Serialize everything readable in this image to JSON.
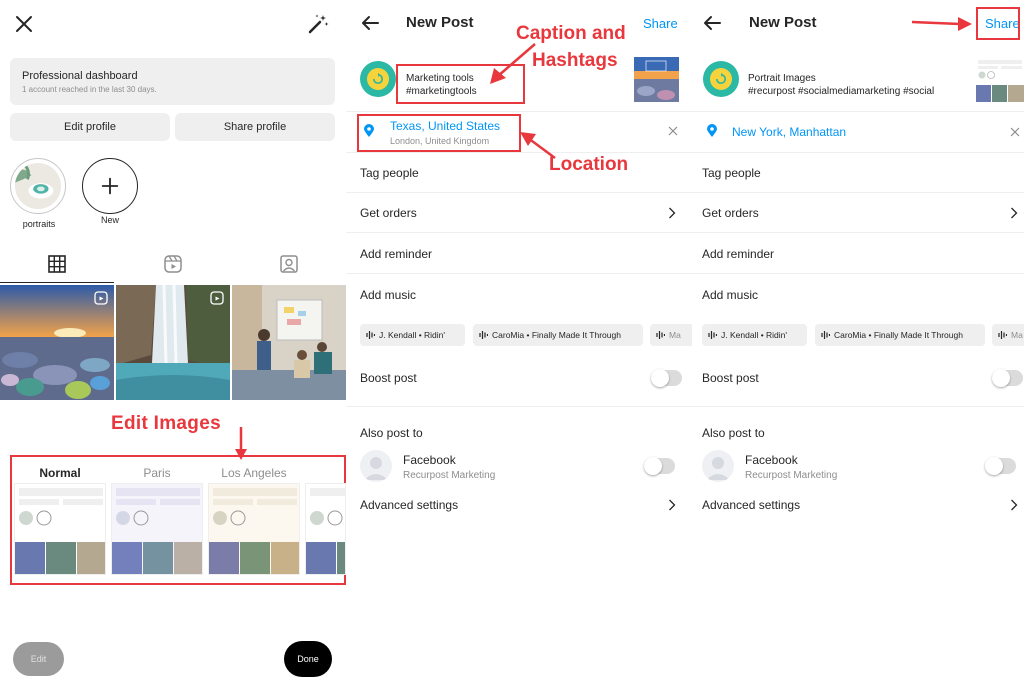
{
  "colors": {
    "annotation_red": "#e8383d",
    "link_blue": "#0095f6",
    "text": "#262626",
    "muted": "#8e8e8e",
    "chip_bg": "#efefef"
  },
  "panel1": {
    "icons": {
      "close": "close-icon",
      "magic": "magic-wand-icon"
    },
    "dashboard": {
      "title": "Professional dashboard",
      "subtitle": "1 account reached in the last 30 days."
    },
    "edit_profile": "Edit profile",
    "share_profile": "Share profile",
    "highlights": [
      {
        "label": "portraits"
      },
      {
        "label": "New"
      }
    ],
    "tabs": [
      "grid-icon",
      "reels-icon",
      "tagged-icon"
    ],
    "annotation": "Edit Images",
    "filters": [
      "Normal",
      "Paris",
      "Los Angeles"
    ],
    "edit_button": "Edit",
    "done_button": "Done"
  },
  "panel2": {
    "title": "New Post",
    "share": "Share",
    "caption_line1": "Marketing tools",
    "caption_line2": "#marketingtools",
    "location_main": "Texas, United States",
    "location_sub": "London, United Kingdom",
    "tag_people": "Tag people",
    "get_orders": "Get orders",
    "add_reminder": "Add reminder",
    "add_music": "Add music",
    "music_chips": [
      "J. Kendall • Ridin'",
      "CaroMia • Finally Made It Through",
      "Ma"
    ],
    "boost_post": "Boost post",
    "also_post_to": "Also post to",
    "facebook_name": "Facebook",
    "facebook_sub": "Recurpost Marketing",
    "advanced_settings": "Advanced settings",
    "annotations": {
      "caption_line1": "Caption and",
      "caption_line2": "Hashtags",
      "location": "Location"
    }
  },
  "panel3": {
    "title": "New Post",
    "share": "Share",
    "caption_line1": "Portrait Images",
    "caption_line2": "#recurpost #socialmediamarketing #social",
    "location_main": "New York, Manhattan",
    "tag_people": "Tag people",
    "get_orders": "Get orders",
    "add_reminder": "Add reminder",
    "add_music": "Add music",
    "music_chips": [
      "J. Kendall • Ridin'",
      "CaroMia • Finally Made It Through",
      "Ma"
    ],
    "boost_post": "Boost post",
    "also_post_to": "Also post to",
    "facebook_name": "Facebook",
    "facebook_sub": "Recurpost Marketing",
    "advanced_settings": "Advanced settings"
  }
}
